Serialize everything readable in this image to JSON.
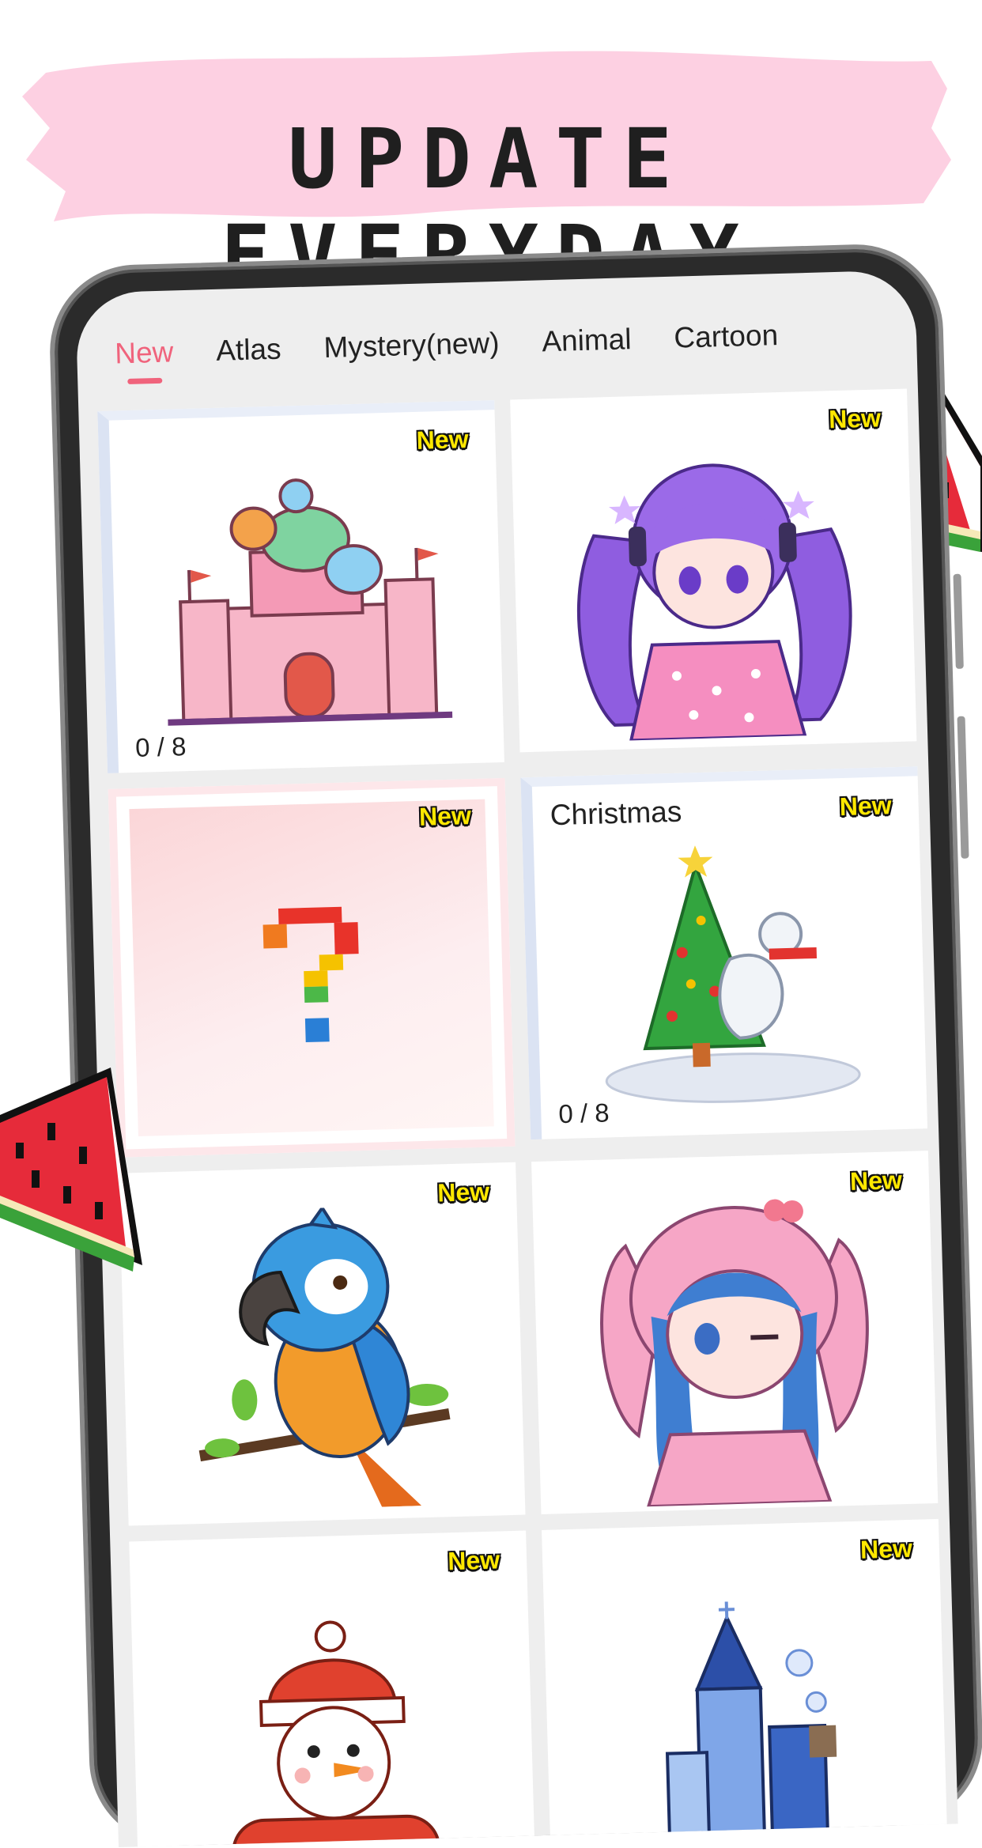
{
  "banner": {
    "title": "UPDATE EVERYDAY",
    "color": "#fdd0e2"
  },
  "tabs": [
    {
      "label": "New",
      "active": true
    },
    {
      "label": "Atlas",
      "active": false
    },
    {
      "label": "Mystery(new)",
      "active": false
    },
    {
      "label": "Animal",
      "active": false
    },
    {
      "label": "Cartoon",
      "active": false
    }
  ],
  "accent_color": "#f0637c",
  "cards": [
    {
      "art": "castle",
      "badge": "New",
      "progress": "0 / 8"
    },
    {
      "art": "anime-girl-purple-twintails",
      "badge": "New"
    },
    {
      "art": "mystery-question-mark",
      "badge": "New"
    },
    {
      "art": "christmas-tree-polar-bear",
      "badge": "New",
      "label": "Christmas",
      "progress": "0 / 8"
    },
    {
      "art": "parrot",
      "badge": "New"
    },
    {
      "art": "anime-girl-bunny-hood",
      "badge": "New"
    },
    {
      "art": "snowman",
      "badge": "New"
    },
    {
      "art": "ice-castle",
      "badge": "New"
    }
  ]
}
